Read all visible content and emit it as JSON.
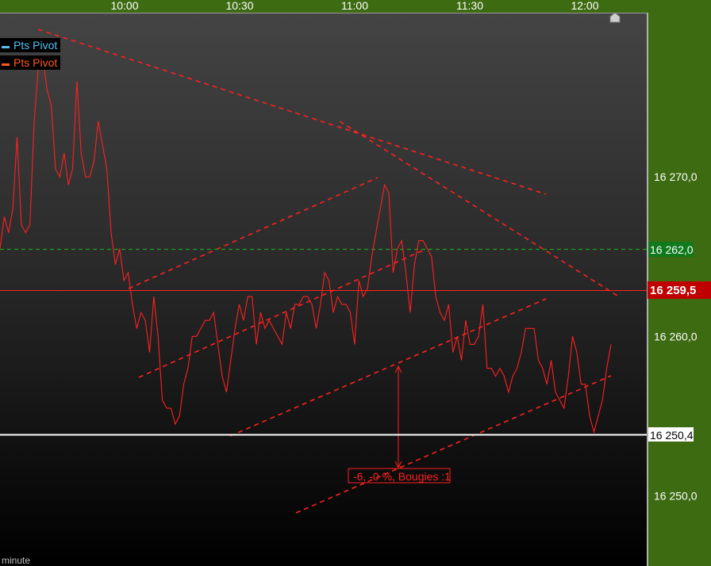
{
  "legend": [
    {
      "label": "Pts Pivot",
      "color": "#4fc3f7"
    },
    {
      "label": "Pts Pivot",
      "color": "#ff5a1f"
    }
  ],
  "timeframe_label": "minute",
  "colors": {
    "price": "#ff2020",
    "pivot_green": "#1fa01f",
    "current_price_tag": "#c00000",
    "axis_bg": "#3d6b12"
  },
  "chart_data": {
    "type": "line",
    "x_ticks": [
      "10:00",
      "10:30",
      "11:00",
      "11:30",
      "12:00"
    ],
    "y_ticks": [
      "16 270,0",
      "16 260,0",
      "16 250,0"
    ],
    "ylim": [
      16245.6,
      16280.3
    ],
    "price_series": [
      16265.5,
      16267.5,
      16266.5,
      16268.0,
      16272.5,
      16267.0,
      16266.5,
      16267.0,
      16273.5,
      16277.0,
      16277.5,
      16275.5,
      16274.5,
      16270.5,
      16270.0,
      16271.5,
      16269.5,
      16270.5,
      16276.0,
      16271.5,
      16270.0,
      16270.0,
      16271.0,
      16273.5,
      16272.0,
      16270.5,
      16266.5,
      16264.5,
      16265.5,
      16263.5,
      16264.0,
      16262.0,
      16260.5,
      16261.5,
      16261.0,
      16259.0,
      16262.5,
      16260.0,
      16256.0,
      16255.5,
      16255.5,
      16254.5,
      16255.0,
      16257.0,
      16258.0,
      16260.0,
      16260.0,
      16260.5,
      16261.0,
      16261.0,
      16261.5,
      16259.5,
      16257.5,
      16256.5,
      16258.5,
      16260.5,
      16262.0,
      16261.0,
      16262.5,
      16262.5,
      16259.5,
      16261.5,
      16260.5,
      16261.0,
      16260.5,
      16260.0,
      16259.5,
      16261.5,
      16260.5,
      16262.0,
      16262.0,
      16262.5,
      16262.5,
      16262.0,
      16260.5,
      16262.0,
      16264.0,
      16263.5,
      16261.5,
      16262.5,
      16262.0,
      16262.0,
      16261.5,
      16259.5,
      16263.5,
      16262.5,
      16263.0,
      16265.0,
      16266.5,
      16268.0,
      16269.5,
      16269.0,
      16264.0,
      16265.5,
      16266.0,
      16264.0,
      16261.5,
      16264.5,
      16266.0,
      16266.0,
      16265.5,
      16265.0,
      16262.5,
      16261.5,
      16261.0,
      16262.0,
      16259.0,
      16260.0,
      16258.5,
      16261.0,
      16259.5,
      16259.5,
      16260.0,
      16262.0,
      16258.0,
      16258.0,
      16257.5,
      16258.0,
      16257.5,
      16256.5,
      16257.5,
      16258.0,
      16259.0,
      16260.5,
      16260.5,
      16260.5,
      16258.5,
      16258.0,
      16257.0,
      16258.5,
      16256.5,
      16256.0,
      16255.5,
      16257.5,
      16260.0,
      16259.0,
      16257.0,
      16257.0,
      16255.0,
      16254.0,
      16255.0,
      16256.0,
      16258.0,
      16259.5
    ],
    "series_x_range": [
      "09:37",
      "12:05"
    ],
    "horizontal_levels": [
      {
        "value": 16262.0,
        "label": "16 262,0",
        "style": "dashed",
        "color": "#1fa01f"
      },
      {
        "value": 16259.5,
        "label": "16 259,5",
        "style": "solid",
        "color": "#ff2020"
      },
      {
        "value": 16250.4,
        "label": "16 250,4",
        "style": "solid",
        "color": "#ffffff"
      }
    ],
    "measure_annotation": "-6, -0 %, Bougies :1",
    "grid": false
  }
}
